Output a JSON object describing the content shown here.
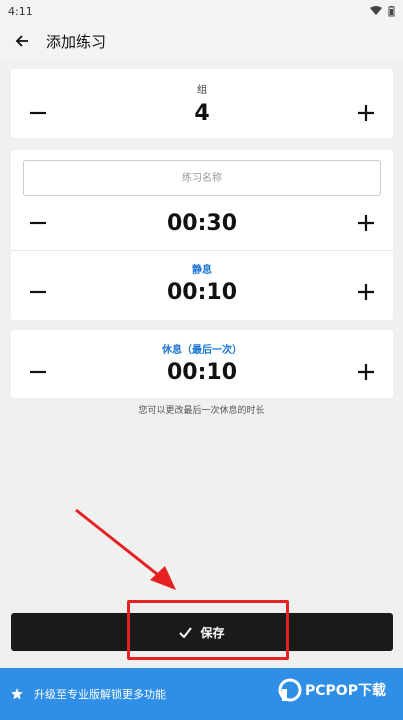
{
  "status": {
    "time": "4:11"
  },
  "app_bar": {
    "title": "添加练习"
  },
  "sets": {
    "label": "组",
    "value": "4"
  },
  "exercise": {
    "name_placeholder": "练习名称",
    "duration": "00:30",
    "rest_label": "静息",
    "rest_value": "00:10"
  },
  "final_rest": {
    "label": "休息（最后一次）",
    "value": "00:10"
  },
  "hint": "您可以更改最后一次休息的时长",
  "save": {
    "label": "保存"
  },
  "promo": {
    "text": "升级至专业版解锁更多功能"
  },
  "watermark": {
    "text": "PCPOP下载"
  },
  "colors": {
    "accent_blue": "#1976d2",
    "promo_bg": "#2f8ee6",
    "save_bg": "#1a1a1a",
    "annotation_red": "#e52222"
  }
}
